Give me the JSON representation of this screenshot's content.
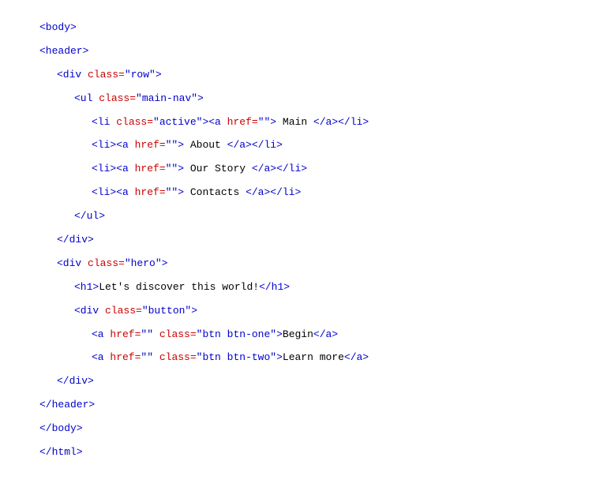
{
  "lines": [
    {
      "indent": 0,
      "parts": [
        {
          "type": "tag",
          "text": "<body>"
        }
      ]
    },
    {
      "indent": 0,
      "parts": [
        {
          "type": "tag",
          "text": "<header>"
        }
      ]
    },
    {
      "indent": 1,
      "parts": [
        {
          "type": "tag",
          "text": "<div "
        },
        {
          "type": "attr-name",
          "text": "class="
        },
        {
          "type": "attr-value",
          "text": "\"row\""
        },
        {
          "type": "tag",
          "text": ">"
        }
      ]
    },
    {
      "indent": 2,
      "parts": [
        {
          "type": "tag",
          "text": "<ul "
        },
        {
          "type": "attr-name",
          "text": "class="
        },
        {
          "type": "attr-value",
          "text": "\"main-nav\""
        },
        {
          "type": "tag",
          "text": ">"
        }
      ]
    },
    {
      "indent": 3,
      "parts": [
        {
          "type": "tag",
          "text": "<li "
        },
        {
          "type": "attr-name",
          "text": "class="
        },
        {
          "type": "attr-value",
          "text": "\"active\""
        },
        {
          "type": "tag",
          "text": "><a "
        },
        {
          "type": "attr-name",
          "text": "href="
        },
        {
          "type": "attr-value",
          "text": "\"\""
        },
        {
          "type": "tag",
          "text": ">"
        },
        {
          "type": "text-content",
          "text": " Main "
        },
        {
          "type": "tag",
          "text": "</a></li>"
        }
      ]
    },
    {
      "indent": 3,
      "parts": [
        {
          "type": "tag",
          "text": "<li><a "
        },
        {
          "type": "attr-name",
          "text": "href="
        },
        {
          "type": "attr-value",
          "text": "\"\""
        },
        {
          "type": "tag",
          "text": ">"
        },
        {
          "type": "text-content",
          "text": " About "
        },
        {
          "type": "tag",
          "text": "</a></li>"
        }
      ]
    },
    {
      "indent": 3,
      "parts": [
        {
          "type": "tag",
          "text": "<li><a "
        },
        {
          "type": "attr-name",
          "text": "href="
        },
        {
          "type": "attr-value",
          "text": "\"\""
        },
        {
          "type": "tag",
          "text": ">"
        },
        {
          "type": "text-content",
          "text": " Our Story "
        },
        {
          "type": "tag",
          "text": "</a></li>"
        }
      ]
    },
    {
      "indent": 3,
      "parts": [
        {
          "type": "tag",
          "text": "<li><a "
        },
        {
          "type": "attr-name",
          "text": "href="
        },
        {
          "type": "attr-value",
          "text": "\"\""
        },
        {
          "type": "tag",
          "text": ">"
        },
        {
          "type": "text-content",
          "text": " Contacts "
        },
        {
          "type": "tag",
          "text": "</a></li>"
        }
      ]
    },
    {
      "indent": 2,
      "parts": [
        {
          "type": "tag",
          "text": "</ul>"
        }
      ]
    },
    {
      "indent": 1,
      "parts": [
        {
          "type": "tag",
          "text": "</div>"
        }
      ]
    },
    {
      "indent": 1,
      "parts": [
        {
          "type": "tag",
          "text": "<div "
        },
        {
          "type": "attr-name",
          "text": "class="
        },
        {
          "type": "attr-value",
          "text": "\"hero\""
        },
        {
          "type": "tag",
          "text": ">"
        }
      ]
    },
    {
      "indent": 2,
      "parts": [
        {
          "type": "tag",
          "text": "<h1>"
        },
        {
          "type": "text-content",
          "text": "Let's discover this world!"
        },
        {
          "type": "tag",
          "text": "</h1>"
        }
      ]
    },
    {
      "indent": 2,
      "parts": [
        {
          "type": "tag",
          "text": "<div "
        },
        {
          "type": "attr-name",
          "text": "class="
        },
        {
          "type": "attr-value",
          "text": "\"button\""
        },
        {
          "type": "tag",
          "text": ">"
        }
      ]
    },
    {
      "indent": 3,
      "parts": [
        {
          "type": "tag",
          "text": "<a "
        },
        {
          "type": "attr-name",
          "text": "href="
        },
        {
          "type": "attr-value",
          "text": "\"\""
        },
        {
          "type": "tag",
          "text": " "
        },
        {
          "type": "attr-name",
          "text": "class="
        },
        {
          "type": "attr-value",
          "text": "\"btn btn-one\""
        },
        {
          "type": "tag",
          "text": ">"
        },
        {
          "type": "text-content",
          "text": "Begin"
        },
        {
          "type": "tag",
          "text": "</a>"
        }
      ]
    },
    {
      "indent": 3,
      "parts": [
        {
          "type": "tag",
          "text": "<a "
        },
        {
          "type": "attr-name",
          "text": "href="
        },
        {
          "type": "attr-value",
          "text": "\"\""
        },
        {
          "type": "tag",
          "text": " "
        },
        {
          "type": "attr-name",
          "text": "class="
        },
        {
          "type": "attr-value",
          "text": "\"btn btn-two\""
        },
        {
          "type": "tag",
          "text": ">"
        },
        {
          "type": "text-content",
          "text": "Learn more"
        },
        {
          "type": "tag",
          "text": "</a>"
        }
      ]
    },
    {
      "indent": 1,
      "parts": [
        {
          "type": "tag",
          "text": "</div>"
        }
      ]
    },
    {
      "indent": 0,
      "parts": [
        {
          "type": "tag",
          "text": "</header>"
        }
      ]
    },
    {
      "indent": 0,
      "parts": [
        {
          "type": "tag",
          "text": "</body>"
        }
      ]
    },
    {
      "indent": 0,
      "parts": [
        {
          "type": "tag",
          "text": "</html>"
        }
      ]
    }
  ]
}
